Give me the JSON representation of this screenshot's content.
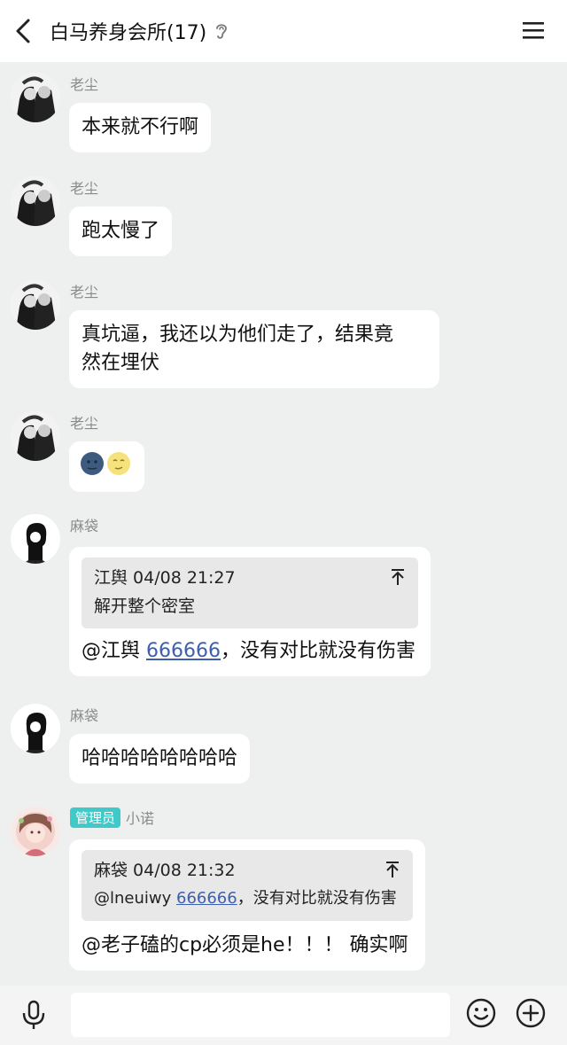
{
  "header": {
    "title": "白马养身会所(17)"
  },
  "messages": [
    {
      "sender": "老尘",
      "text": "本来就不行啊"
    },
    {
      "sender": "老尘",
      "text": "跑太慢了"
    },
    {
      "sender": "老尘",
      "line1": "真坑逼，我还以为他们走了，结果竟",
      "line2": "然在埋伏"
    },
    {
      "sender": "老尘",
      "emoji": "🌚🌝"
    },
    {
      "sender": "麻袋",
      "quote": {
        "head": "江舆 04/08 21:27",
        "body": "解开整个密室"
      },
      "mention": "@江舆 ",
      "link": "666666",
      "rest": "，没有对比就没有伤害"
    },
    {
      "sender": "麻袋",
      "text": "哈哈哈哈哈哈哈哈"
    },
    {
      "sender": "小诺",
      "badge": "管理员",
      "quote": {
        "head": "麻袋 04/08 21:32",
        "mention": "@lneuiwy ",
        "link": "666666",
        "rest": "，没有对比就没有伤害"
      },
      "text": "@老子磕的cp必须是he！！！ 确实啊"
    }
  ],
  "input": {
    "value": ""
  }
}
